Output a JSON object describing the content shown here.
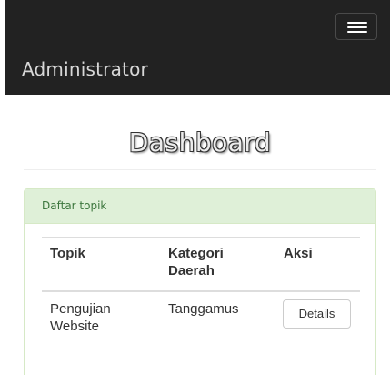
{
  "navbar": {
    "brand": "Administrator",
    "toggle_icon": "hamburger-menu-icon"
  },
  "page": {
    "title": "Dashboard"
  },
  "panel": {
    "heading": "Daftar topik",
    "table": {
      "columns": [
        "Topik",
        "Kategori Daerah",
        "Aksi"
      ],
      "rows": [
        {
          "topik": "Pengujian Website",
          "kategori": "Tanggamus",
          "action_label": "Details"
        }
      ]
    }
  },
  "colors": {
    "navbar_bg": "#222222",
    "panel_heading_bg": "#dff0d8",
    "panel_heading_text": "#3c763d",
    "panel_border": "#d6e9c6"
  }
}
